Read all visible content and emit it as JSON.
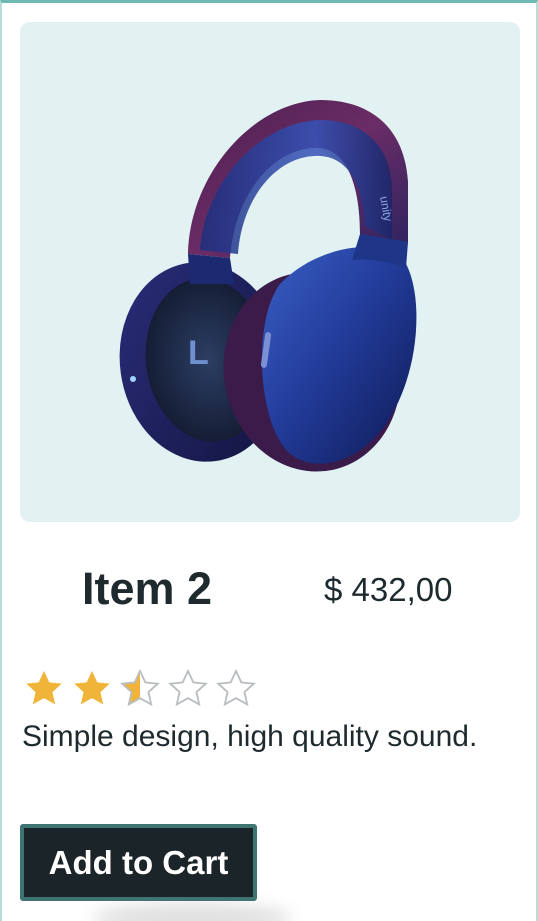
{
  "product": {
    "image_alt": "headphones",
    "name": "Item 2",
    "price": "$ 432,00",
    "rating": 2.5,
    "rating_max": 5,
    "description": "Simple design, high quality sound.",
    "add_to_cart_label": "Add to Cart"
  },
  "colors": {
    "accent_border": "#6fb9b4",
    "image_background": "#e2f1f2",
    "star_filled": "#f1b43b",
    "star_empty": "#b9bdbf",
    "button_background": "#1b2428",
    "button_border": "#3e7471",
    "text": "#1f2a2e"
  },
  "icons": {
    "star": "star-icon"
  }
}
